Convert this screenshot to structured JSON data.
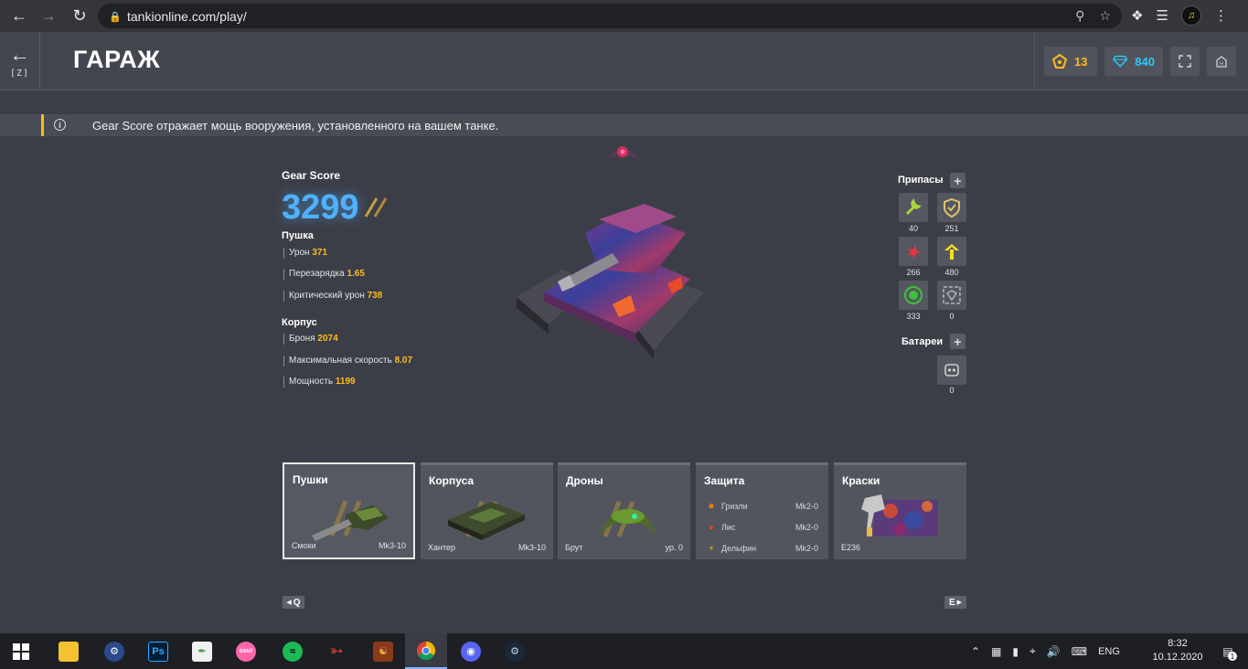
{
  "browser": {
    "url": "tankionline.com/play/"
  },
  "header": {
    "back_key": "[Z]",
    "title": "ГАРАЖ",
    "stars": "13",
    "crystals": "840"
  },
  "info": {
    "text": "Gear Score отражает мощь вооружения, установленного на вашем танке."
  },
  "gear": {
    "label": "Gear Score",
    "value": "3299",
    "turret_title": "Пушка",
    "turret_stats": [
      {
        "label": "Урон",
        "value": "371"
      },
      {
        "label": "Перезарядка",
        "value": "1.65"
      },
      {
        "label": "Критический урон",
        "value": "738"
      }
    ],
    "hull_title": "Корпус",
    "hull_stats": [
      {
        "label": "Броня",
        "value": "2074"
      },
      {
        "label": "Максимальная скорость",
        "value": "8.07"
      },
      {
        "label": "Мощность",
        "value": "1199"
      }
    ]
  },
  "supplies": {
    "title": "Припасы",
    "items": [
      {
        "icon": "repair-kit-icon",
        "count": "40",
        "color": "#a6d63a"
      },
      {
        "icon": "double-armor-icon",
        "count": "251",
        "color": "#e0c46a"
      },
      {
        "icon": "double-damage-icon",
        "count": "266",
        "color": "#e8343a"
      },
      {
        "icon": "speed-boost-icon",
        "count": "480",
        "color": "#f5e21a"
      },
      {
        "icon": "mine-icon",
        "count": "333",
        "color": "#39c23a"
      },
      {
        "icon": "gold-box-icon",
        "count": "0",
        "color": "#b5b5b5"
      }
    ],
    "batteries_title": "Батареи",
    "batteries_count": "0"
  },
  "categories": [
    {
      "title": "Пушки",
      "item": "Смоки",
      "level": "Mk3-10"
    },
    {
      "title": "Корпуса",
      "item": "Хантер",
      "level": "Mk3-10"
    },
    {
      "title": "Дроны",
      "item": "Брут",
      "level": "ур. 0"
    },
    {
      "title": "Защита",
      "rows": [
        {
          "name": "Гризли",
          "level": "Mk2-0"
        },
        {
          "name": "Лис",
          "level": "Mk2-0"
        },
        {
          "name": "Дельфин",
          "level": "Mk2-0"
        }
      ]
    },
    {
      "title": "Краски",
      "item": "E236"
    }
  ],
  "nav_keys": {
    "prev": "Q",
    "next": "E"
  },
  "taskbar": {
    "lang": "ENG",
    "time": "8:32",
    "date": "10.12.2020",
    "notif_count": "1",
    "ps_label": "Ps",
    "osu_label": "osu!"
  }
}
